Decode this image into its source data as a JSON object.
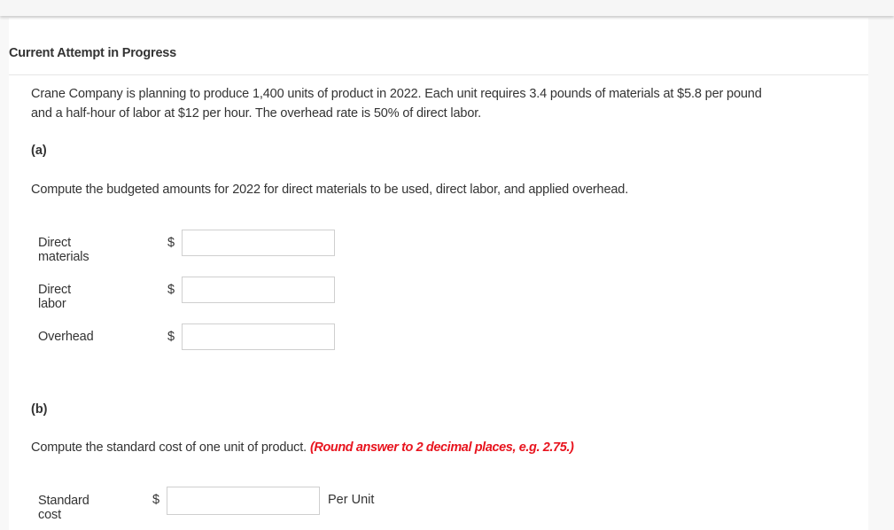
{
  "header": {
    "title": "Current Attempt in Progress"
  },
  "problem": {
    "line1": "Crane Company is planning to produce 1,400 units of product in 2022. Each unit requires 3.4 pounds of materials at $5.8 per pound",
    "line2": "and a half-hour of labor at $12 per hour. The overhead rate is 50% of direct labor."
  },
  "part_a": {
    "label": "(a)",
    "instruction": "Compute the budgeted amounts for 2022 for direct materials to be used, direct labor, and applied overhead.",
    "rows": [
      {
        "label": "Direct materials",
        "currency": "$",
        "value": ""
      },
      {
        "label": "Direct labor",
        "currency": "$",
        "value": ""
      },
      {
        "label": "Overhead",
        "currency": "$",
        "value": ""
      }
    ]
  },
  "part_b": {
    "label": "(b)",
    "instruction": "Compute the standard cost of one unit of product.",
    "note": "(Round answer to 2 decimal places, e.g. 2.75.)",
    "row": {
      "label": "Standard cost",
      "currency": "$",
      "value": "",
      "unit": "Per Unit"
    }
  },
  "colors": {
    "note_red": "#e8141e",
    "text": "#333333"
  }
}
